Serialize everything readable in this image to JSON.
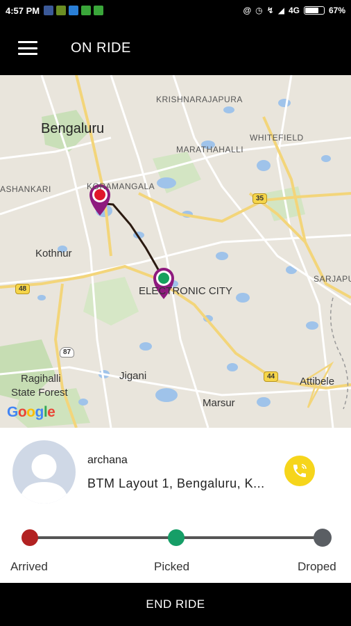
{
  "status_bar": {
    "time": "4:57 PM",
    "network": "4G",
    "battery": "67%",
    "battery_level": 0.67
  },
  "app_bar": {
    "title": "ON RIDE",
    "menu_icon": "hamburger-menu-icon"
  },
  "map": {
    "labels": {
      "bengaluru": "Bengaluru",
      "krishnarajapura": "KRISHNARAJAPURA",
      "whitefield": "WHITEFIELD",
      "marathahalli": "MARATHAHALLI",
      "ashankari": "ASHANKARI",
      "koramangala": "KORAMANGALA",
      "kothnur": "Kothnur",
      "electronic_city": "ELECTRONIC CITY",
      "sarjapur": "SARJAPU",
      "ragihalli": "Ragihalli",
      "state_forest": "State Forest",
      "jigani": "Jigani",
      "marsur": "Marsur",
      "attibele": "Attibele"
    },
    "shields": {
      "h35": "35",
      "h48": "48",
      "h87": "87",
      "h44": "44"
    },
    "google_logo": [
      "G",
      "o",
      "o",
      "g",
      "l",
      "e"
    ],
    "colors": {
      "pickup_pin": "#e0162b",
      "drop_pin": "#16a05d",
      "pin_ring": "#8e1a7e",
      "route": "#2b1a10"
    }
  },
  "rider": {
    "name": "archana",
    "address": "BTM Layout 1, Bengaluru, K..."
  },
  "progress": {
    "steps": [
      {
        "label": "Arrived",
        "color": "#b22222"
      },
      {
        "label": "Picked",
        "color": "#169e67"
      },
      {
        "label": "Droped",
        "color": "#5a5e63"
      }
    ]
  },
  "actions": {
    "end_ride": "END RIDE",
    "call_color": "#f6d51b"
  }
}
